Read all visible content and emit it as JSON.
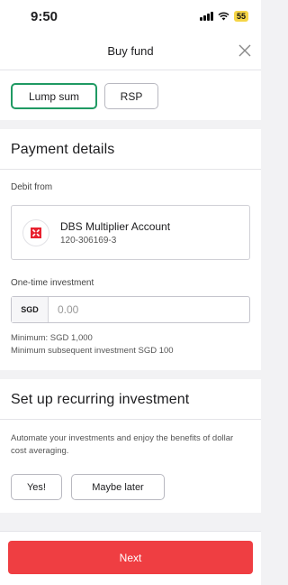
{
  "status_bar": {
    "time": "9:50",
    "battery": "55"
  },
  "header": {
    "title": "Buy fund"
  },
  "mode_toggle": {
    "options": [
      "Lump sum",
      "RSP"
    ],
    "selected": "Lump sum"
  },
  "payment": {
    "title": "Payment details",
    "debit_label": "Debit from",
    "account_name": "DBS Multiplier Account",
    "account_number": "120-306169-3",
    "investment_label": "One-time investment",
    "currency": "SGD",
    "amount_placeholder": "0.00",
    "minimum": "Minimum: SGD 1,000",
    "minimum_subsequent": "Minimum subsequent investment SGD 100"
  },
  "recurring": {
    "title": "Set up recurring investment",
    "description": "Automate your investments and enjoy the benefits of dollar cost averaging.",
    "yes_label": "Yes!",
    "later_label": "Maybe later"
  },
  "footer": {
    "next_label": "Next"
  },
  "colors": {
    "accent_green": "#1f9a63",
    "primary_red": "#ef3e42",
    "battery_yellow": "#f5d547"
  },
  "icons": [
    "signal-icon",
    "wifi-icon",
    "battery-icon",
    "close-icon",
    "dbs-logo-icon"
  ]
}
